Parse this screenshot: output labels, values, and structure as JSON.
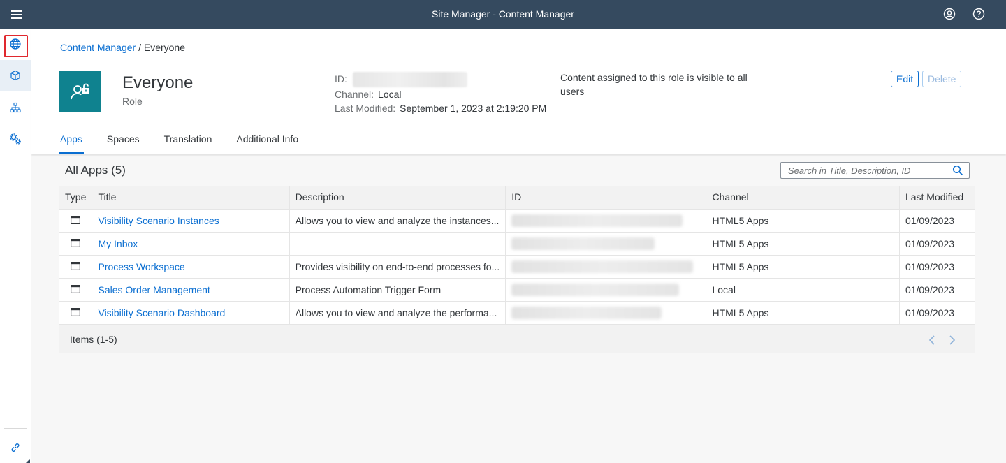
{
  "shell": {
    "title": "Site Manager - Content Manager",
    "menu_icon": "hamburger-icon",
    "user_icon": "user-circle-icon",
    "help_icon": "help-icon"
  },
  "sidenav": {
    "items": [
      {
        "icon": "globe-icon",
        "name": "sidenav-globe",
        "highlighted": true
      },
      {
        "icon": "cube-icon",
        "name": "sidenav-content",
        "selected": true
      },
      {
        "icon": "hierarchy-icon",
        "name": "sidenav-hierarchy"
      },
      {
        "icon": "gears-icon",
        "name": "sidenav-settings"
      }
    ],
    "bottom_item": {
      "icon": "link-icon"
    }
  },
  "breadcrumb": {
    "link": "Content Manager",
    "separator": "/",
    "current": "Everyone"
  },
  "object": {
    "title": "Everyone",
    "subtitle": "Role",
    "avatar_icon": "user-lock-icon",
    "avatar_color": "#0f828f"
  },
  "attributes": {
    "id_label": "ID:",
    "channel_label": "Channel:",
    "channel_value": "Local",
    "modified_label": "Last Modified:",
    "modified_value": "September 1, 2023 at 2:19:20 PM"
  },
  "description": "Content assigned to this role is visible to all users",
  "actions": {
    "edit": "Edit",
    "delete": "Delete"
  },
  "tabs": [
    {
      "label": "Apps",
      "active": true
    },
    {
      "label": "Spaces"
    },
    {
      "label": "Translation"
    },
    {
      "label": "Additional Info"
    }
  ],
  "table": {
    "title": "All Apps (5)",
    "search_placeholder": "Search in Title, Description, ID",
    "columns": [
      "Type",
      "Title",
      "Description",
      "ID",
      "Channel",
      "Last Modified"
    ],
    "rows": [
      {
        "title": "Visibility Scenario Instances",
        "description": "Allows you to view and analyze the instances...",
        "channel": "HTML5 Apps",
        "modified": "01/09/2023"
      },
      {
        "title": "My Inbox",
        "description": "",
        "channel": "HTML5 Apps",
        "modified": "01/09/2023"
      },
      {
        "title": "Process Workspace",
        "description": "Provides visibility on end-to-end processes fo...",
        "channel": "HTML5 Apps",
        "modified": "01/09/2023"
      },
      {
        "title": "Sales Order Management",
        "description": "Process Automation Trigger Form",
        "channel": "Local",
        "modified": "01/09/2023"
      },
      {
        "title": "Visibility Scenario Dashboard",
        "description": "Allows you to view and analyze the performa...",
        "channel": "HTML5 Apps",
        "modified": "01/09/2023"
      }
    ],
    "footer": "Items (1-5)"
  },
  "colors": {
    "shell": "#354a5f",
    "link": "#0a6ed1",
    "highlight_box": "#e0282e"
  }
}
